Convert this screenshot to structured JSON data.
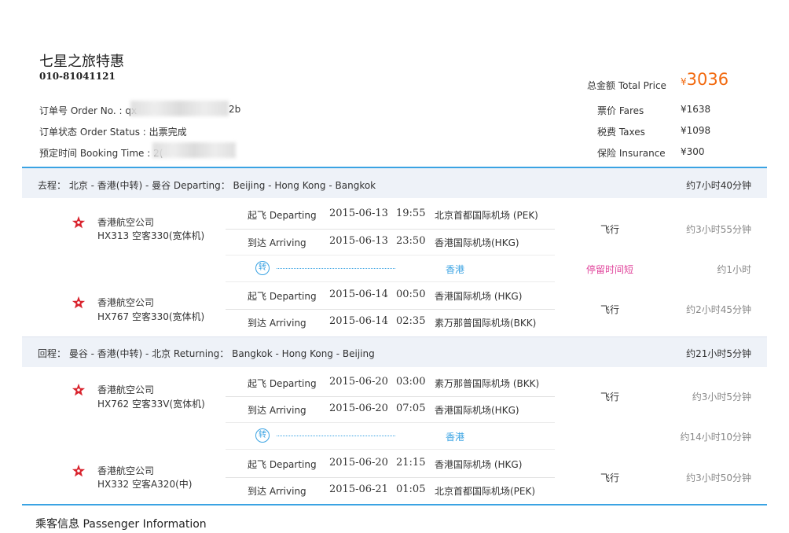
{
  "company": {
    "name": "七星之旅特惠",
    "phone": "010-81041121"
  },
  "price": {
    "total_label": "总金额 Total Price",
    "currency": "¥",
    "total_value": "3036",
    "fares_label": "票价 Fares",
    "fares_value": "¥1638",
    "taxes_label": "税费 Taxes",
    "taxes_value": "¥1098",
    "insurance_label": "保险 Insurance",
    "insurance_value": "¥300"
  },
  "order": {
    "number_label": "订单号 Order No. : qx",
    "number_suffix": "2b",
    "status_label": "订单状态 Order Status : 出票完成",
    "time_label": "预定时间 Booking Time : 2("
  },
  "outbound": {
    "header_left": "去程： 北京 - 香港(中转) - 曼谷     Departing： Beijing - Hong Kong - Bangkok",
    "header_right": "约7小时40分钟",
    "flights": [
      {
        "airline": "香港航空公司",
        "code": "HX313 空客330(宽体机)",
        "dep_label": "起飞 Departing",
        "dep_date": "2015-06-13",
        "dep_time": "19:55",
        "dep_airport": "北京首都国际机场 (PEK)",
        "arr_label": "到达 Arriving",
        "arr_date": "2015-06-13",
        "arr_time": "23:50",
        "arr_airport": "香港国际机场(HKG)",
        "fly": "飞行",
        "duration": "约3小时55分钟"
      },
      {
        "airline": "香港航空公司",
        "code": "HX767 空客330(宽体机)",
        "dep_label": "起飞 Departing",
        "dep_date": "2015-06-14",
        "dep_time": "00:50",
        "dep_airport": "香港国际机场 (HKG)",
        "arr_label": "到达 Arriving",
        "arr_date": "2015-06-14",
        "arr_time": "02:35",
        "arr_airport": "素万那普国际机场(BKK)",
        "fly": "飞行",
        "duration": "约2小时45分钟"
      }
    ],
    "transfer": {
      "icon": "转",
      "city": "香港",
      "note": "停留时间短",
      "duration": "约1小时"
    }
  },
  "return": {
    "header_left": "回程： 曼谷 - 香港(中转) - 北京     Returning： Bangkok - Hong Kong - Beijing",
    "header_right": "约21小时5分钟",
    "flights": [
      {
        "airline": "香港航空公司",
        "code": "HX762 空客33V(宽体机)",
        "dep_label": "起飞 Departing",
        "dep_date": "2015-06-20",
        "dep_time": "03:00",
        "dep_airport": "素万那普国际机场 (BKK)",
        "arr_label": "到达 Arriving",
        "arr_date": "2015-06-20",
        "arr_time": "07:05",
        "arr_airport": "香港国际机场(HKG)",
        "fly": "飞行",
        "duration": "约3小时5分钟"
      },
      {
        "airline": "香港航空公司",
        "code": "HX332 空客A320(中)",
        "dep_label": "起飞 Departing",
        "dep_date": "2015-06-20",
        "dep_time": "21:15",
        "dep_airport": "香港国际机场 (HKG)",
        "arr_label": "到达 Arriving",
        "arr_date": "2015-06-21",
        "arr_time": "01:05",
        "arr_airport": "北京首都国际机场(PEK)",
        "fly": "飞行",
        "duration": "约3小时50分钟"
      }
    ],
    "transfer": {
      "icon": "转",
      "city": "香港",
      "duration": "约14小时10分钟"
    }
  },
  "passenger": {
    "title": "乘客信息 Passenger Information"
  },
  "colors": {
    "accent": "#3aa3e3",
    "price": "#f26a10",
    "warning": "#e0429a",
    "airline_red": "#d9232d"
  },
  "icons": {
    "airline": "bauhinia-logo-icon",
    "transfer": "transfer-icon"
  }
}
